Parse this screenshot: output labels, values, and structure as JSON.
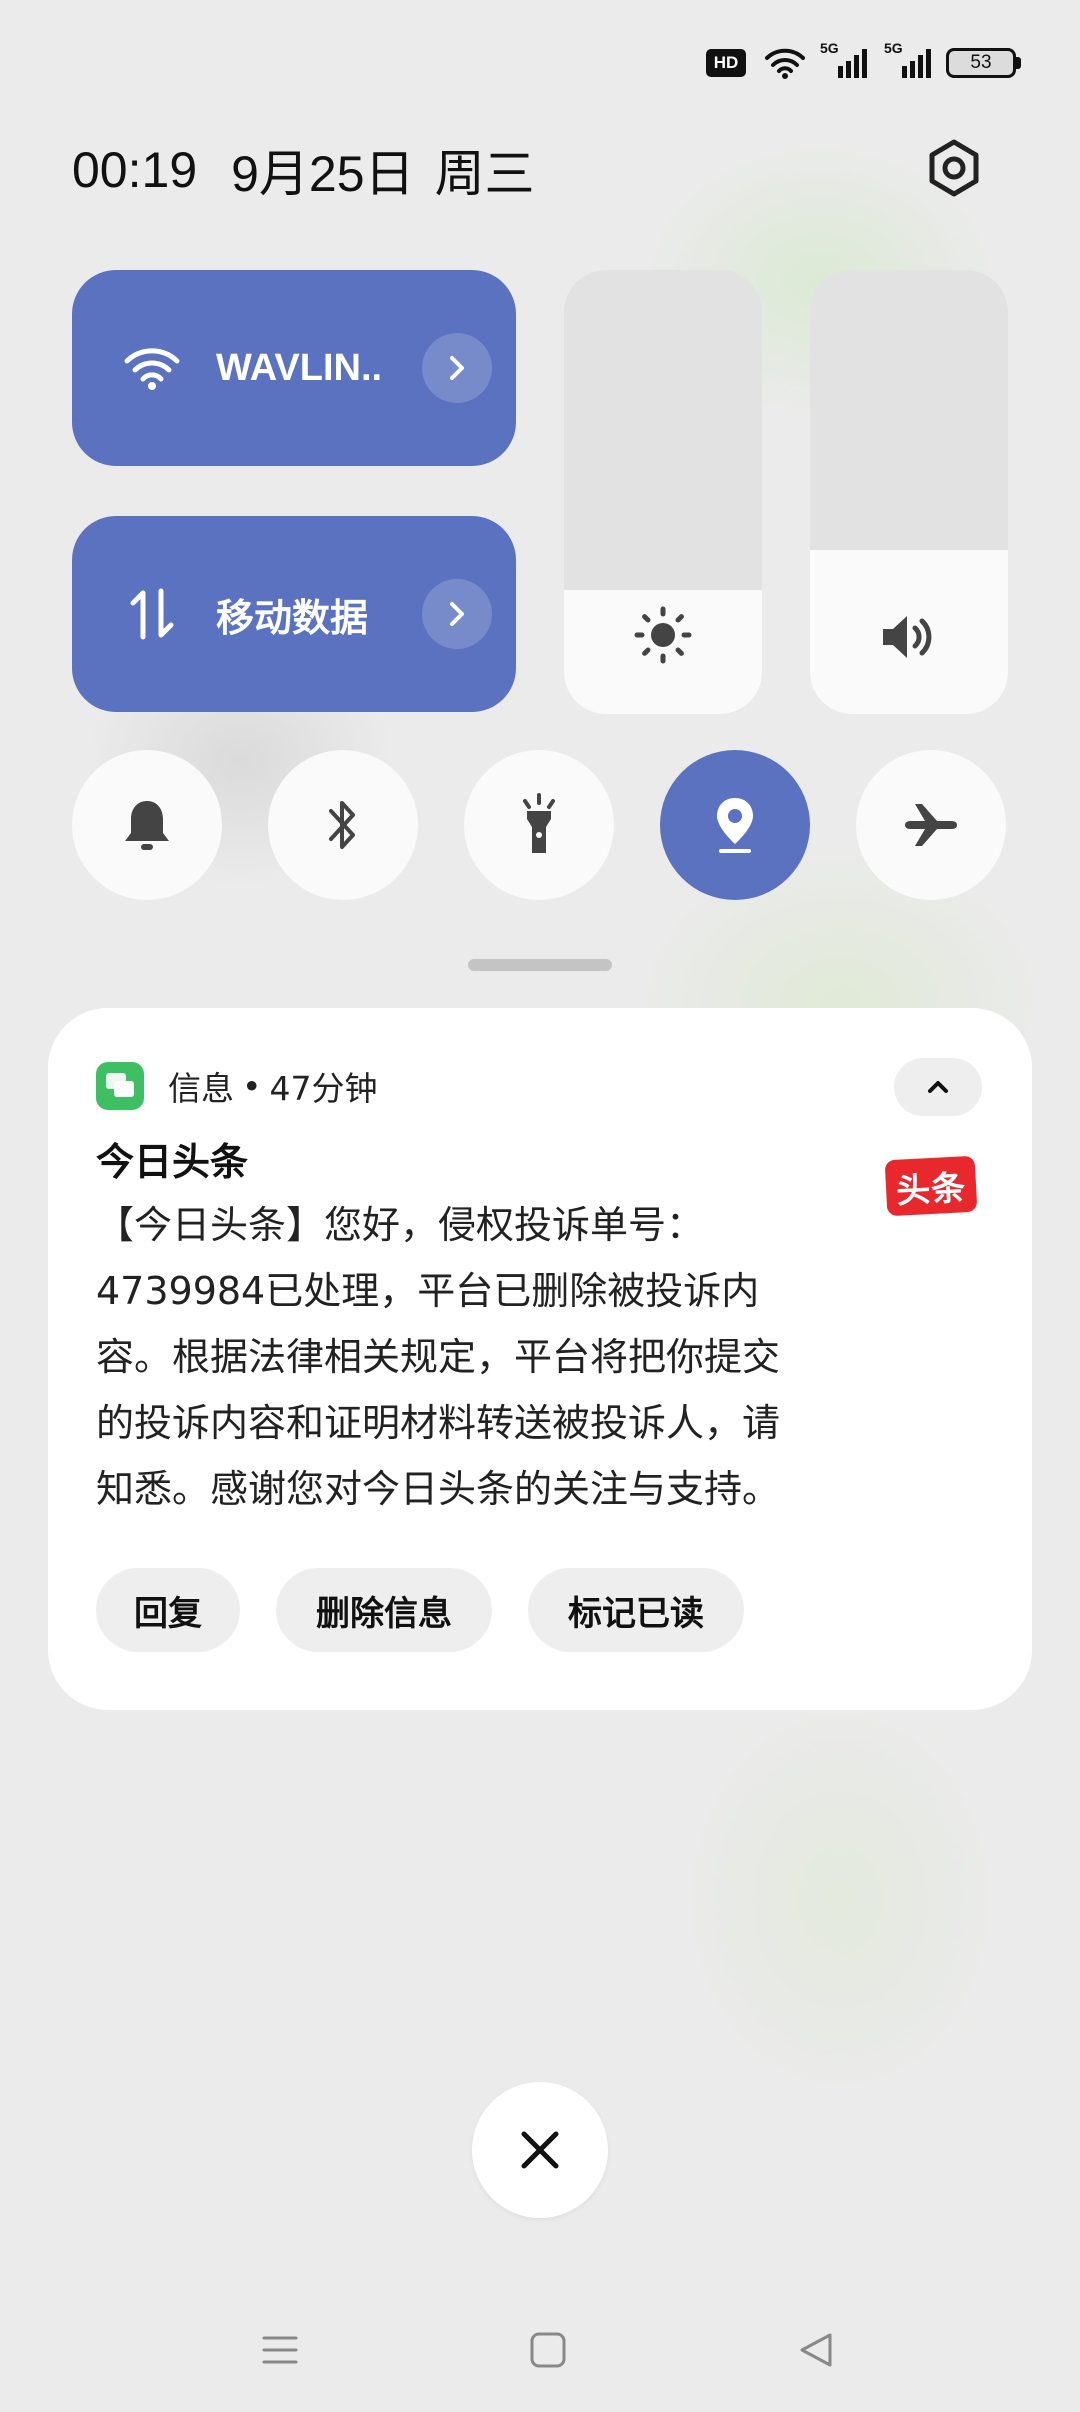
{
  "status_bar": {
    "hd_label": "HD",
    "network_1": "5G",
    "network_2": "5G",
    "battery_level": "53"
  },
  "header": {
    "time": "00:19",
    "date": "9月25日",
    "weekday": "周三"
  },
  "quick_settings": {
    "wifi_tile": {
      "label": "WAVLIN..",
      "icon": "wifi-icon"
    },
    "data_tile": {
      "label": "移动数据",
      "icon": "data-arrows-icon"
    },
    "brightness_level": 0.28,
    "volume_level": 0.37,
    "toggles": [
      {
        "name": "bell",
        "active": false
      },
      {
        "name": "bluetooth",
        "active": false
      },
      {
        "name": "flashlight",
        "active": false
      },
      {
        "name": "location",
        "active": true
      },
      {
        "name": "airplane",
        "active": false
      }
    ]
  },
  "notification": {
    "app_name": "信息",
    "separator": "•",
    "age": "47分钟",
    "title": "今日头条",
    "lines": [
      "【今日头条】您好，侵权投诉单号：",
      "4739984已处理，平台已删除被投诉内",
      "容。根据法律相关规定，平台将把你提交",
      "的投诉内容和证明材料转送被投诉人，请",
      "知悉。感谢您对今日头条的关注与支持。"
    ],
    "thumb_text": "头条",
    "actions": {
      "reply": "回复",
      "delete": "删除信息",
      "mark_read": "标记已读"
    }
  },
  "colors": {
    "accent": "#5a72bf",
    "card_bg": "#ffffff",
    "background": "#ebebeb",
    "thumb_red": "#e8282c"
  }
}
